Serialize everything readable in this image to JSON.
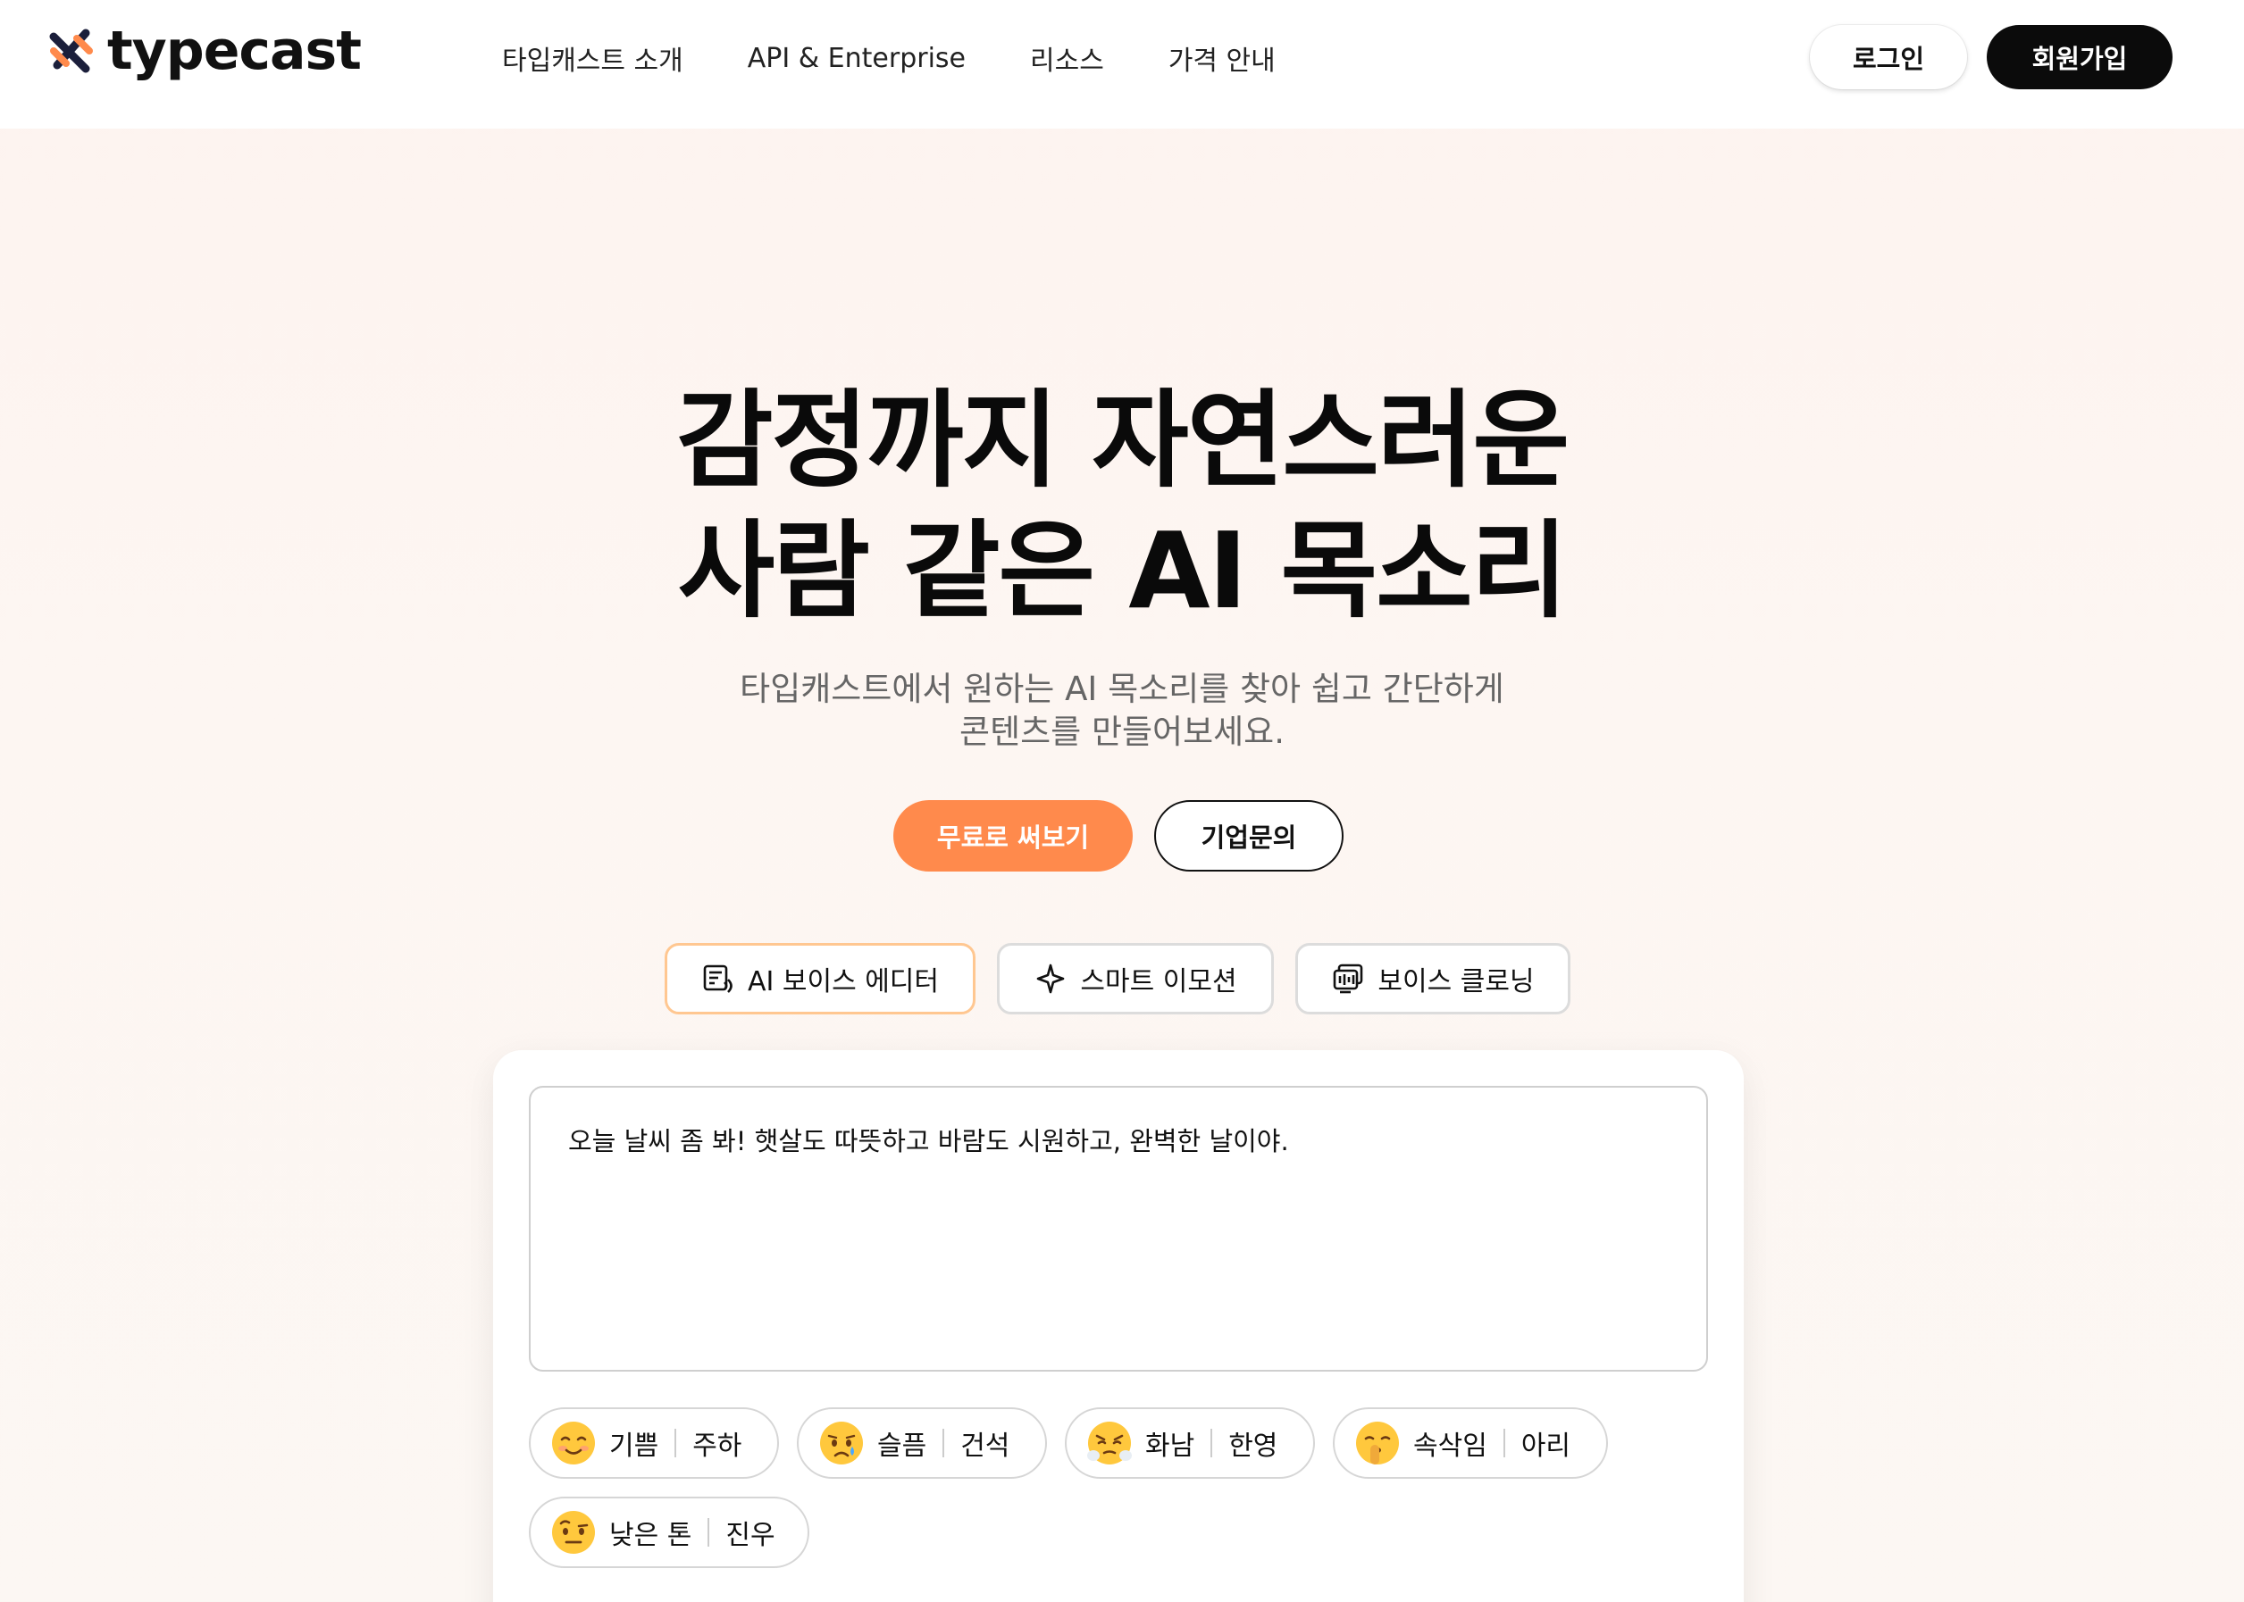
{
  "brand": {
    "name": "typecast",
    "accent": "#ff8a4c"
  },
  "nav": {
    "items": [
      "타입캐스트 소개",
      "API & Enterprise",
      "리소스",
      "가격 안내"
    ],
    "login_label": "로그인",
    "signup_label": "회원가입"
  },
  "hero": {
    "title_lines": [
      "감정까지 자연스러운",
      "사람 같은 AI 목소리"
    ],
    "subtitle_lines": [
      "타입캐스트에서 원하는 AI 목소리를 찾아 쉽고 간단하게",
      "콘텐츠를 만들어보세요."
    ],
    "primary_cta": "무료로 써보기",
    "secondary_cta": "기업문의"
  },
  "feature_tabs": [
    {
      "label": "AI 보이스 에디터",
      "icon": "voice-editor-icon",
      "active": true
    },
    {
      "label": "스마트 이모션",
      "icon": "sparkle-icon",
      "active": false
    },
    {
      "label": "보이스 클로닝",
      "icon": "voice-cloning-icon",
      "active": false
    }
  ],
  "editor": {
    "text": "오늘 날씨 좀 봐! 햇살도 따뜻하고 바람도 시원하고, 완벽한 날이야."
  },
  "emotions": [
    {
      "emotion": "기쁨",
      "voice": "주하",
      "emoji": "smiling-face-icon"
    },
    {
      "emotion": "슬픔",
      "voice": "건석",
      "emoji": "crying-face-icon"
    },
    {
      "emotion": "화남",
      "voice": "한영",
      "emoji": "steam-face-icon"
    },
    {
      "emotion": "속삭임",
      "voice": "아리",
      "emoji": "shushing-face-icon"
    },
    {
      "emotion": "낮은 톤",
      "voice": "진우",
      "emoji": "raised-eyebrow-face-icon"
    }
  ]
}
